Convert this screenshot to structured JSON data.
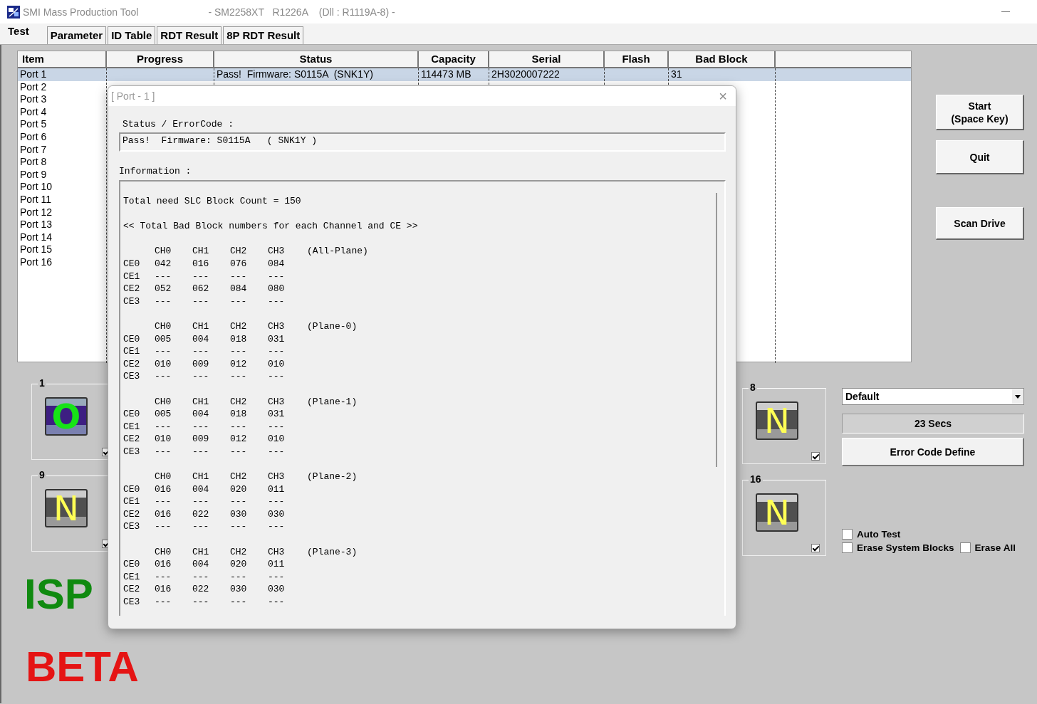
{
  "window": {
    "title": "SMI Mass Production Tool",
    "subtitle": "- SM2258XT   R1226A    (Dll : R1119A-8) -"
  },
  "tabs": [
    {
      "label": "Test",
      "selected": true
    },
    {
      "label": "Parameter",
      "selected": false
    },
    {
      "label": "ID Table",
      "selected": false
    },
    {
      "label": "RDT Result",
      "selected": false
    },
    {
      "label": "8P RDT Result",
      "selected": false
    }
  ],
  "table": {
    "columns": [
      "Item",
      "Progress",
      "Status",
      "Capacity",
      "Serial",
      "Flash",
      "Bad Block"
    ],
    "rows": [
      {
        "selected": true,
        "cells": [
          "Port 1",
          null,
          "Pass!  Firmware: S0115A  (SNK1Y)",
          "114473 MB",
          "2H3020007222",
          null,
          "31"
        ]
      },
      {
        "selected": false,
        "cells": [
          "Port 2"
        ]
      },
      {
        "selected": false,
        "cells": [
          "Port 3"
        ]
      },
      {
        "selected": false,
        "cells": [
          "Port 4"
        ]
      },
      {
        "selected": false,
        "cells": [
          "Port 5"
        ]
      },
      {
        "selected": false,
        "cells": [
          "Port 6"
        ]
      },
      {
        "selected": false,
        "cells": [
          "Port 7"
        ]
      },
      {
        "selected": false,
        "cells": [
          "Port 8"
        ]
      },
      {
        "selected": false,
        "cells": [
          "Port 9"
        ]
      },
      {
        "selected": false,
        "cells": [
          "Port 10"
        ]
      },
      {
        "selected": false,
        "cells": [
          "Port 11"
        ]
      },
      {
        "selected": false,
        "cells": [
          "Port 12"
        ]
      },
      {
        "selected": false,
        "cells": [
          "Port 13"
        ]
      },
      {
        "selected": false,
        "cells": [
          "Port 14"
        ]
      },
      {
        "selected": false,
        "cells": [
          "Port 15"
        ]
      },
      {
        "selected": false,
        "cells": [
          "Port 16"
        ]
      }
    ]
  },
  "buttons": [
    "Start\n(Space Key)",
    "Quit",
    "Scan Drive"
  ],
  "left_tiles": [
    {
      "number": "1",
      "letter": "O",
      "kind": "ok",
      "checked": true
    },
    {
      "number": "9",
      "letter": "N",
      "kind": "none",
      "checked": true
    }
  ],
  "right_tiles": [
    {
      "number": "8",
      "letter": "N",
      "kind": "none",
      "checked": true
    },
    {
      "number": "16",
      "letter": "N",
      "kind": "none",
      "checked": true
    }
  ],
  "logos": [
    "ISP",
    "BETA"
  ],
  "controls": {
    "dropdown": "Default",
    "timer": "23 Secs",
    "error_button": "Error Code Define",
    "checkboxes": [
      {
        "label": "Auto Test",
        "checked": false
      },
      {
        "label": "Erase System Blocks",
        "checked": false
      },
      {
        "label": "Erase All",
        "checked": false
      }
    ]
  },
  "dialog": {
    "title": "[ Port - 1 ]",
    "close": "×",
    "status_label": "Status / ErrorCode :",
    "status_value": "Pass!  Firmware: S0115A   ( SNK1Y )",
    "info_label": "Information :",
    "blocks": [
      {
        "kind": "text",
        "text": "Total need SLC Block Count = 150"
      },
      {
        "kind": "text",
        "text": "<< Total Bad Block numbers for each Channel and CE >>"
      },
      {
        "kind": "grid",
        "columns": [
          "CH0",
          "CH1",
          "CH2",
          "CH3"
        ],
        "note": "(All-Plane)",
        "rows": [
          {
            "ce": "CE0",
            "values": [
              "042",
              "016",
              "076",
              "084"
            ]
          },
          {
            "ce": "CE1",
            "values": [
              "---",
              "---",
              "---",
              "---"
            ]
          },
          {
            "ce": "CE2",
            "values": [
              "052",
              "062",
              "084",
              "080"
            ]
          },
          {
            "ce": "CE3",
            "values": [
              "---",
              "---",
              "---",
              "---"
            ]
          }
        ]
      },
      {
        "kind": "grid",
        "columns": [
          "CH0",
          "CH1",
          "CH2",
          "CH3"
        ],
        "note": "(Plane-0)",
        "rows": [
          {
            "ce": "CE0",
            "values": [
              "005",
              "004",
              "018",
              "031"
            ]
          },
          {
            "ce": "CE1",
            "values": [
              "---",
              "---",
              "---",
              "---"
            ]
          },
          {
            "ce": "CE2",
            "values": [
              "010",
              "009",
              "012",
              "010"
            ]
          },
          {
            "ce": "CE3",
            "values": [
              "---",
              "---",
              "---",
              "---"
            ]
          }
        ]
      },
      {
        "kind": "grid",
        "columns": [
          "CH0",
          "CH1",
          "CH2",
          "CH3"
        ],
        "note": "(Plane-1)",
        "rows": [
          {
            "ce": "CE0",
            "values": [
              "005",
              "004",
              "018",
              "031"
            ]
          },
          {
            "ce": "CE1",
            "values": [
              "---",
              "---",
              "---",
              "---"
            ]
          },
          {
            "ce": "CE2",
            "values": [
              "010",
              "009",
              "012",
              "010"
            ]
          },
          {
            "ce": "CE3",
            "values": [
              "---",
              "---",
              "---",
              "---"
            ]
          }
        ]
      },
      {
        "kind": "grid",
        "columns": [
          "CH0",
          "CH1",
          "CH2",
          "CH3"
        ],
        "note": "(Plane-2)",
        "rows": [
          {
            "ce": "CE0",
            "values": [
              "016",
              "004",
              "020",
              "011"
            ]
          },
          {
            "ce": "CE1",
            "values": [
              "---",
              "---",
              "---",
              "---"
            ]
          },
          {
            "ce": "CE2",
            "values": [
              "016",
              "022",
              "030",
              "030"
            ]
          },
          {
            "ce": "CE3",
            "values": [
              "---",
              "---",
              "---",
              "---"
            ]
          }
        ]
      },
      {
        "kind": "grid",
        "columns": [
          "CH0",
          "CH1",
          "CH2",
          "CH3"
        ],
        "note": "(Plane-3)",
        "rows": [
          {
            "ce": "CE0",
            "values": [
              "016",
              "004",
              "020",
              "011"
            ]
          },
          {
            "ce": "CE1",
            "values": [
              "---",
              "---",
              "---",
              "---"
            ]
          },
          {
            "ce": "CE2",
            "values": [
              "016",
              "022",
              "030",
              "030"
            ]
          },
          {
            "ce": "CE3",
            "values": [
              "---",
              "---",
              "---",
              "---"
            ]
          }
        ]
      }
    ]
  }
}
